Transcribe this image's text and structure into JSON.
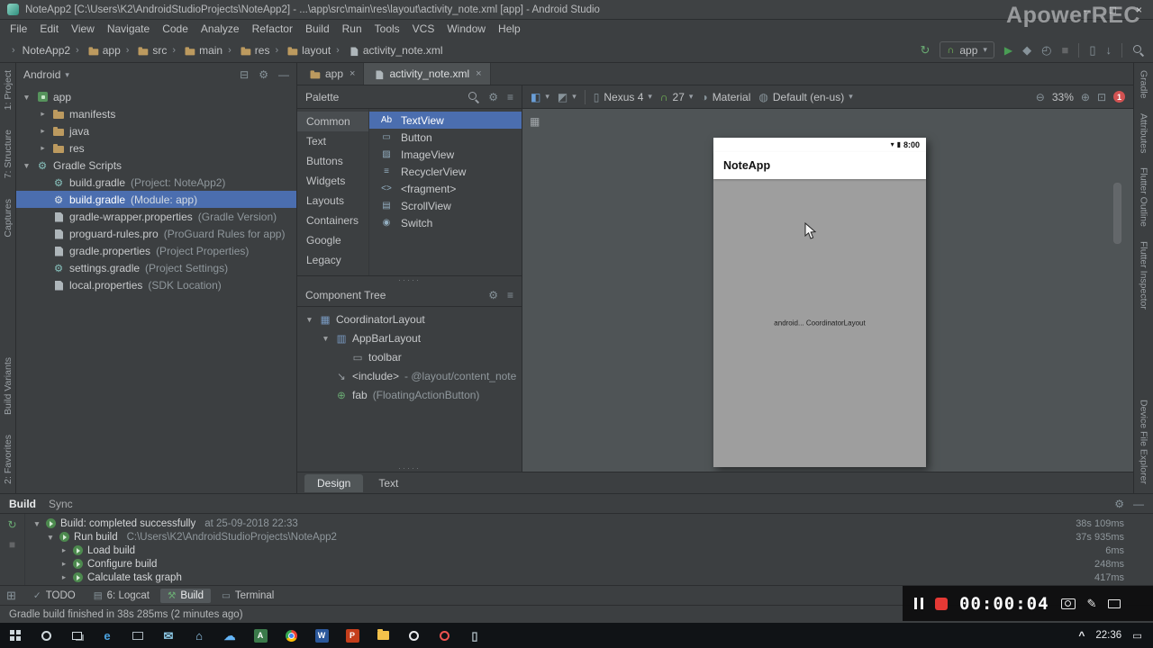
{
  "icons": {
    "minimize": "–",
    "maximize": "□",
    "close": "×",
    "dropdown": "▾",
    "crumb_sep": "›",
    "gear": "⚙",
    "collapse_all": "⊟",
    "hide": "—",
    "menu": "≡",
    "dots": "·····",
    "grid": "▦",
    "run": "▶",
    "sync": "↻",
    "debug": "◆",
    "profiler": "◴",
    "stop": "■",
    "avd_phone": "▯",
    "sdk_download": "↓",
    "android_head": "∩",
    "design_surface": "◧",
    "orientation": "◩",
    "device_phone": "▯",
    "theme": "◑",
    "locale": "◍",
    "zoom_out": "⊖",
    "zoom_in": "⊕",
    "zoom_fit": "⊡",
    "signal": "▾",
    "battery": "▮",
    "switcher": "⊞",
    "pencil": "✎",
    "tray_expand": "^",
    "action_center": "▭"
  },
  "title_bar": {
    "app_title": "NoteApp2 [C:\\Users\\K2\\AndroidStudioProjects\\NoteApp2] - ...\\app\\src\\main\\res\\layout\\activity_note.xml [app] - Android Studio",
    "watermark": "ApowerREC"
  },
  "menu": [
    "File",
    "Edit",
    "View",
    "Navigate",
    "Code",
    "Analyze",
    "Refactor",
    "Build",
    "Run",
    "Tools",
    "VCS",
    "Window",
    "Help"
  ],
  "toolbar": {
    "run_config": "app",
    "breadcrumbs": [
      {
        "label": "NoteApp2"
      },
      {
        "label": "app",
        "icon": "folder"
      },
      {
        "label": "src",
        "icon": "folder"
      },
      {
        "label": "main",
        "icon": "folder"
      },
      {
        "label": "res",
        "icon": "folder"
      },
      {
        "label": "layout",
        "icon": "folder"
      },
      {
        "label": "activity_note.xml",
        "icon": "file"
      }
    ]
  },
  "stripes": {
    "left_top": [
      "1: Project",
      "7: Structure",
      "Captures"
    ],
    "left_bottom": [
      "Build Variants",
      "2: Favorites"
    ],
    "right_top": [
      "Gradle",
      "Attributes",
      "Flutter Outline",
      "Flutter Inspector"
    ],
    "right_bottom": [
      "Device File Explorer"
    ]
  },
  "project": {
    "view": "Android",
    "tree": [
      {
        "arrow": "▼",
        "icon": "module",
        "label": "app",
        "level": 0
      },
      {
        "arrow": "▸",
        "icon": "folder",
        "label": "manifests",
        "level": 1
      },
      {
        "arrow": "▸",
        "icon": "folder",
        "label": "java",
        "level": 1
      },
      {
        "arrow": "▸",
        "icon": "folder",
        "label": "res",
        "level": 1
      },
      {
        "arrow": "▼",
        "glyph": "⚙",
        "icon_color": "#87c1bc",
        "label": "Gradle Scripts",
        "level": 0
      },
      {
        "glyph": "⚙",
        "icon_color": "#87c1bc",
        "label": "build.gradle",
        "detail": "(Project: NoteApp2)",
        "level": 1
      },
      {
        "glyph": "⚙",
        "icon_color": "#dce3e8",
        "label": "build.gradle",
        "detail": "(Module: app)",
        "level": 1,
        "selected": true
      },
      {
        "icon": "file",
        "label": "gradle-wrapper.properties",
        "detail": "(Gradle Version)",
        "level": 1
      },
      {
        "icon": "file",
        "label": "proguard-rules.pro",
        "detail": "(ProGuard Rules for app)",
        "level": 1
      },
      {
        "icon": "file",
        "label": "gradle.properties",
        "detail": "(Project Properties)",
        "level": 1
      },
      {
        "glyph": "⚙",
        "icon_color": "#87c1bc",
        "label": "settings.gradle",
        "detail": "(Project Settings)",
        "level": 1
      },
      {
        "icon": "file",
        "label": "local.properties",
        "detail": "(SDK Location)",
        "level": 1
      }
    ]
  },
  "editor_tabs": [
    {
      "label": "app",
      "icon": "folder"
    },
    {
      "label": "activity_note.xml",
      "icon": "file",
      "active": true
    }
  ],
  "palette": {
    "title": "Palette",
    "categories": [
      {
        "label": "Common",
        "selected": true
      },
      {
        "label": "Text"
      },
      {
        "label": "Buttons"
      },
      {
        "label": "Widgets"
      },
      {
        "label": "Layouts"
      },
      {
        "label": "Containers"
      },
      {
        "label": "Google"
      },
      {
        "label": "Legacy"
      }
    ],
    "items": [
      {
        "glyph": "Ab",
        "label": "TextView",
        "selected": true
      },
      {
        "glyph": "▭",
        "label": "Button"
      },
      {
        "glyph": "▨",
        "label": "ImageView"
      },
      {
        "glyph": "≡",
        "label": "RecyclerView"
      },
      {
        "glyph": "<>",
        "label": "<fragment>"
      },
      {
        "glyph": "▤",
        "label": "ScrollView"
      },
      {
        "glyph": "◉",
        "label": "Switch"
      }
    ]
  },
  "component_tree": {
    "title": "Component Tree",
    "nodes": [
      {
        "arrow": "▼",
        "glyph": "▦",
        "icon_color": "#7a9cc4",
        "label": "CoordinatorLayout",
        "level": 0
      },
      {
        "arrow": "▼",
        "glyph": "▥",
        "icon_color": "#7a9cc4",
        "label": "AppBarLayout",
        "level": 1
      },
      {
        "glyph": "▭",
        "icon_color": "#9aa0a5",
        "label": "toolbar",
        "level": 2
      },
      {
        "arrow": "",
        "glyph": "↘",
        "icon_color": "#9aa0a5",
        "label": "<include>",
        "detail": "- @layout/content_note",
        "level": 1
      },
      {
        "arrow": "",
        "glyph": "⊕",
        "icon_color": "#6aab73",
        "label": "fab",
        "detail": "(FloatingActionButton)",
        "level": 1
      }
    ]
  },
  "canvas": {
    "device": "Nexus 4",
    "api": "27",
    "theme": "Material",
    "locale": "Default (en-us)",
    "zoom": "33%",
    "error_count": "1",
    "phone": {
      "time": "8:00",
      "app_title": "NoteApp",
      "center_text": "android... CoordinatorLayout"
    }
  },
  "mode_tabs": [
    {
      "label": "Design",
      "active": true
    },
    {
      "label": "Text"
    }
  ],
  "build": {
    "tabs": [
      {
        "label": "Build",
        "active": true
      },
      {
        "label": "Sync"
      }
    ],
    "rows": [
      {
        "arrow": "▼",
        "label": "Build: completed successfully",
        "detail": "at 25-09-2018 22:33",
        "duration": "38s 109ms",
        "level": 0
      },
      {
        "arrow": "▼",
        "label": "Run build",
        "detail": "C:\\Users\\K2\\AndroidStudioProjects\\NoteApp2",
        "duration": "37s 935ms",
        "level": 1
      },
      {
        "arrow": "▸",
        "label": "Load build",
        "duration": "6ms",
        "level": 2
      },
      {
        "arrow": "▸",
        "label": "Configure build",
        "duration": "248ms",
        "level": 2
      },
      {
        "arrow": "▸",
        "label": "Calculate task graph",
        "duration": "417ms",
        "level": 2
      }
    ]
  },
  "tool_windows": [
    {
      "glyph": "✓",
      "label": "TODO"
    },
    {
      "glyph": "▤",
      "label": "6: Logcat"
    },
    {
      "glyph": "⚒",
      "label": "Build",
      "active": true,
      "icon_color": "#6aab73"
    },
    {
      "glyph": "▭",
      "label": "Terminal"
    }
  ],
  "status_bar": {
    "message": "Gradle build finished in 38s 285ms (2 minutes ago)"
  },
  "recorder": {
    "timer": "00:00:04"
  },
  "taskbar": {
    "time": "22:36",
    "apps": [
      {
        "name": "start-button",
        "icon": "win"
      },
      {
        "name": "search-button",
        "icon": "circle",
        "color": "#cfd8dc"
      },
      {
        "name": "task-view-button",
        "icon": "tasks",
        "color": "#cfd8dc"
      },
      {
        "name": "edge-browser-icon",
        "icon": "glyph",
        "glyph": "e",
        "color": "#4aa3e0"
      },
      {
        "name": "media-player-icon",
        "icon": "square-outline",
        "color": "#aab4bb"
      },
      {
        "name": "mail-app-icon",
        "icon": "glyph",
        "glyph": "✉",
        "color": "#8ecbe8"
      },
      {
        "name": "store-icon",
        "icon": "glyph",
        "glyph": "⌂",
        "color": "#9ad0f5"
      },
      {
        "name": "onedrive-icon",
        "icon": "glyph",
        "glyph": "☁",
        "color": "#64b5f6"
      },
      {
        "name": "android-studio-icon",
        "icon": "square",
        "glyph": "A",
        "color": "#3b7a4a"
      },
      {
        "name": "chrome-browser-icon",
        "icon": "chrome"
      },
      {
        "name": "word-icon",
        "icon": "square",
        "glyph": "W",
        "color": "#2b579a"
      },
      {
        "name": "powerpoint-icon",
        "icon": "square",
        "glyph": "P",
        "color": "#c43e1c"
      },
      {
        "name": "file-explorer-icon",
        "icon": "folder",
        "color": "#f2c14b"
      },
      {
        "name": "photos-app-icon",
        "icon": "circle",
        "color": "#e8eaed"
      },
      {
        "name": "lab-tool-icon",
        "icon": "circle",
        "color": "#ef5350"
      },
      {
        "name": "your-phone-icon",
        "icon": "glyph",
        "glyph": "▯",
        "color": "#b0bec5"
      }
    ]
  }
}
